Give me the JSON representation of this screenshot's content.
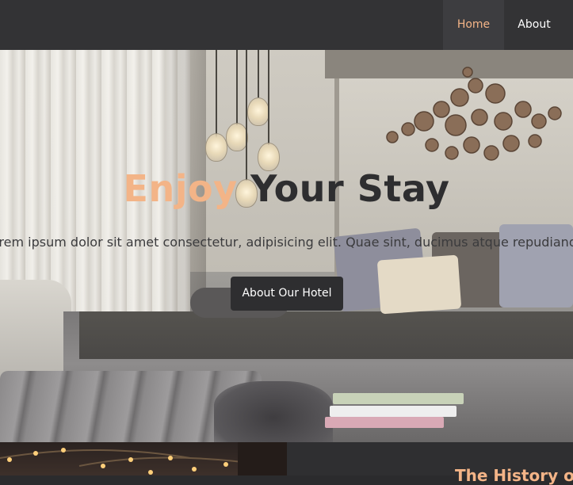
{
  "nav": {
    "items": [
      {
        "label": "Home",
        "active": true
      },
      {
        "label": "About",
        "active": false
      }
    ]
  },
  "hero": {
    "title_accent": "Enjoy",
    "title_main": "Your Stay",
    "text": "Lorem ipsum dolor sit amet consectetur, adipisicing elit. Quae sint, ducimus atque repudiandae impedit quas",
    "button_label": "About Our Hotel"
  },
  "section": {
    "heading": "The History of"
  },
  "colors": {
    "accent": "#f3b487",
    "dark": "#2e2e30",
    "nav_bg": "#333335"
  }
}
